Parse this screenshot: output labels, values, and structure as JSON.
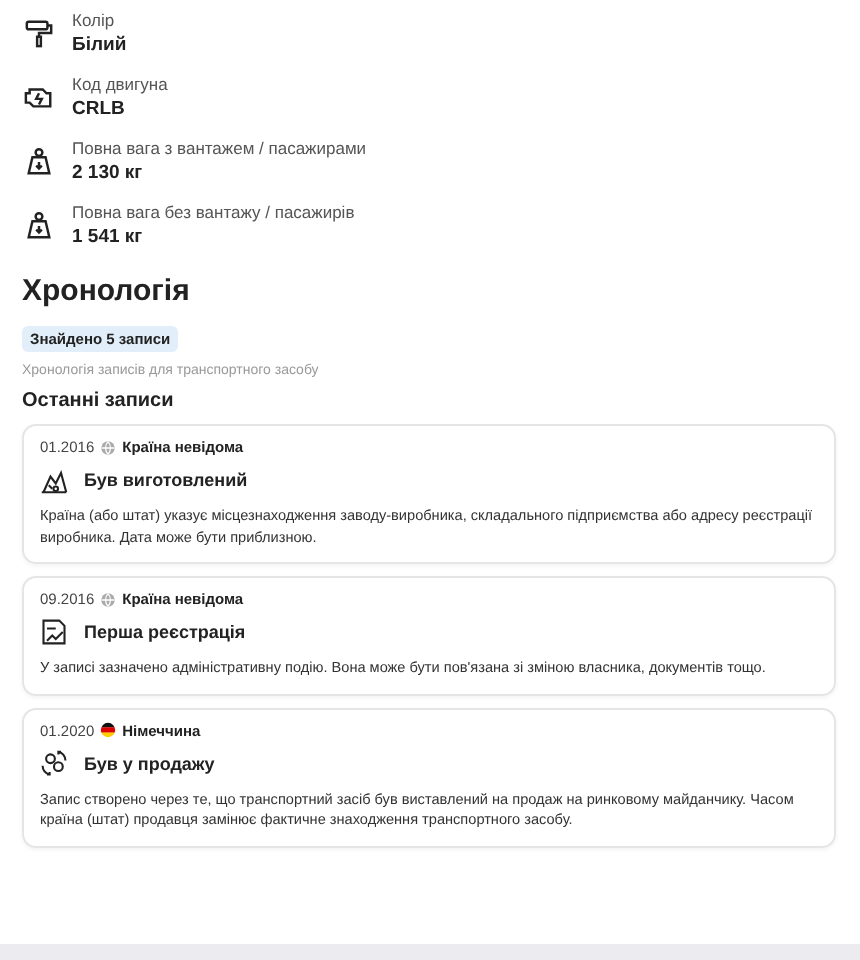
{
  "specs": [
    {
      "kind": "roller",
      "label": "Колір",
      "value": "Білий"
    },
    {
      "kind": "engine",
      "label": "Код двигуна",
      "value": "CRLB"
    },
    {
      "kind": "weight",
      "label": "Повна вага з вантажем / пасажирами",
      "value": "2 130 кг"
    },
    {
      "kind": "weight",
      "label": "Повна вага без вантажу / пасажирів",
      "value": "1 541 кг"
    }
  ],
  "timeline": {
    "title": "Хронологія",
    "badge": "Знайдено 5 записи",
    "subtitle": "Хронологія записів для транспортного засобу",
    "section": "Останні записи",
    "records": [
      {
        "date": "01.2016",
        "country": {
          "kind": "globe",
          "name": "Країна невідома"
        },
        "event": {
          "kind": "factory",
          "title": "Був виготовлений"
        },
        "text": "Країна (або штат) указує місцезнаходження заводу-виробника, складального підприємства або адресу реєстрації виробника. Дата може бути приблизною."
      },
      {
        "date": "09.2016",
        "country": {
          "kind": "globe",
          "name": "Країна невідома"
        },
        "event": {
          "kind": "document",
          "title": "Перша реєстрація"
        },
        "text": "У записі зазначено адміністративну подію. Вона може бути пов'язана зі зміною власника, документів тощо."
      },
      {
        "date": "01.2020",
        "country": {
          "kind": "flag",
          "name": "Німеччина"
        },
        "event": {
          "kind": "exchange",
          "title": "Був у продажу"
        },
        "text": "Запис створено через те, що транспортний засіб був виставлений на продаж на ринковому майданчику. Часом країна (штат) продавця замінює фактичне знаходження транспортного засобу."
      }
    ]
  }
}
